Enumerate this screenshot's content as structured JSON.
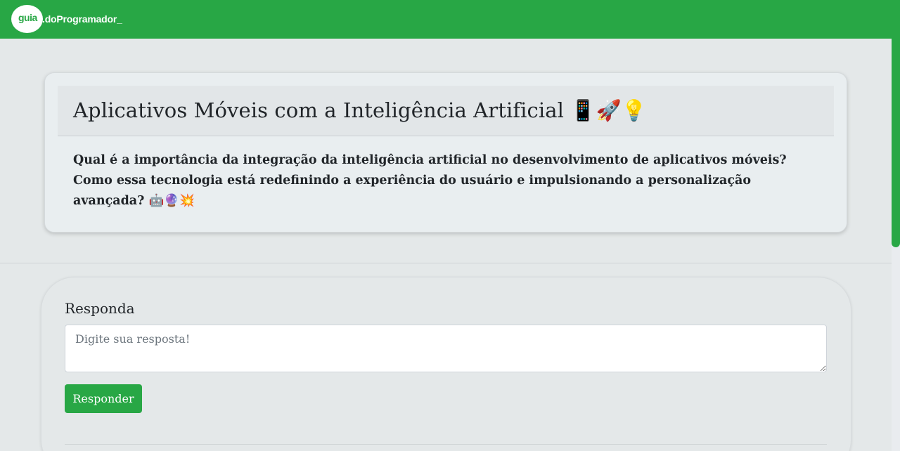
{
  "header": {
    "logo_prefix": ">",
    "logo_mark": "guia",
    "logo_text": ".doProgramador_",
    "brand_color": "#28a745"
  },
  "question": {
    "title": "Aplicativos Móveis com a Inteligência Artificial 📱🚀💡",
    "body": "Qual é a importância da integração da inteligência artificial no desenvolvimento de aplicativos móveis? Como essa tecnologia está redefinindo a experiência do usuário e impulsionando a personalização avançada? 🤖🔮💥"
  },
  "answer": {
    "label": "Responda",
    "placeholder": "Digite sua resposta!",
    "submit_label": "Responder"
  }
}
